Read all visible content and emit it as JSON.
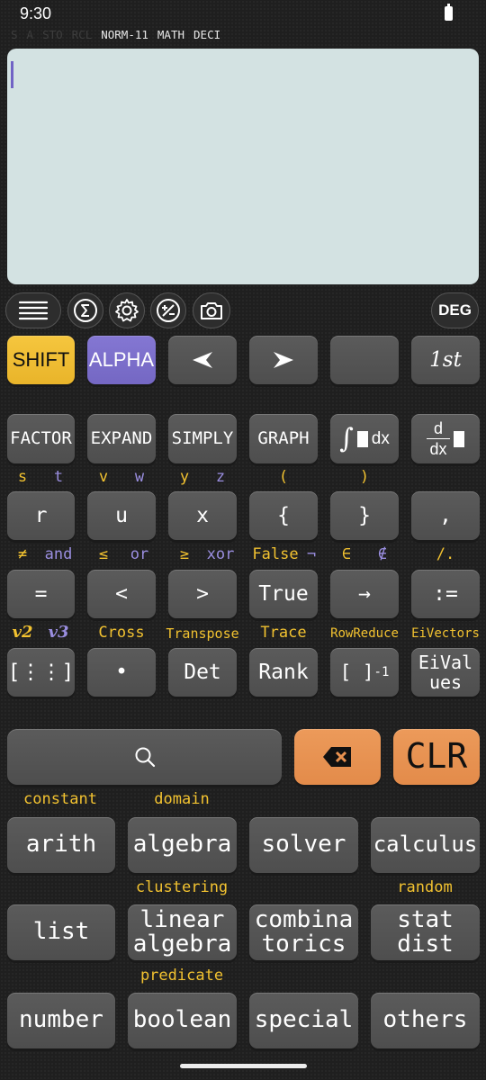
{
  "status": {
    "time": "9:30"
  },
  "indicators": [
    "S",
    "A",
    "STO",
    "RCL",
    "NORM-11",
    "MATH",
    "DECI"
  ],
  "toolbar": {
    "deg": "DEG"
  },
  "row1": {
    "shift": "SHIFT",
    "alpha": "ALPHA",
    "left": "◀",
    "right": "▶",
    "first": "1st"
  },
  "row2": {
    "factor": "FACTOR",
    "expand": "EXPAND",
    "simply": "SIMPLY",
    "graph": "GRAPH",
    "integral": "∫",
    "dx": "dx",
    "d": "d"
  },
  "labels3": [
    "s",
    "t",
    "v",
    "w",
    "y",
    "z",
    "(",
    ")"
  ],
  "row3": [
    "r",
    "u",
    "x",
    "{",
    "}",
    ","
  ],
  "labels4": [
    "≠",
    "and",
    "≤",
    "or",
    "≥",
    "xor",
    "False",
    "¬",
    "∈",
    "∉",
    "/."
  ],
  "row4": [
    "=",
    "<",
    ">",
    "True",
    "→",
    ":="
  ],
  "labels5": [
    "v2",
    "v3",
    "Cross",
    "Transpose",
    "Trace",
    "RowReduce",
    "EiVectors"
  ],
  "row5": {
    "matrix": "[⋮⋮]",
    "dot": "•",
    "det": "Det",
    "rank": "Rank",
    "inverse": "[ ]",
    "inverse_exp": "-1",
    "eival1": "EiVal",
    "eival2": "ues"
  },
  "clr": "CLR",
  "func_labels": {
    "constant": "constant",
    "domain": "domain",
    "clustering": "clustering",
    "random": "random",
    "predicate": "predicate"
  },
  "func": [
    [
      "arith",
      "algebra",
      "solver",
      "calculus"
    ],
    [
      "list",
      "linear\nalgebra",
      "combina\ntorics",
      "stat\ndist"
    ],
    [
      "number",
      "boolean",
      "special",
      "others"
    ]
  ],
  "colors": {
    "shift": "#f0be35",
    "alpha": "#7a6cc8",
    "label_yellow": "#f2c230",
    "label_purple": "#9a8ee0",
    "orange": "#e8914f",
    "display": "#d3e2e2"
  }
}
